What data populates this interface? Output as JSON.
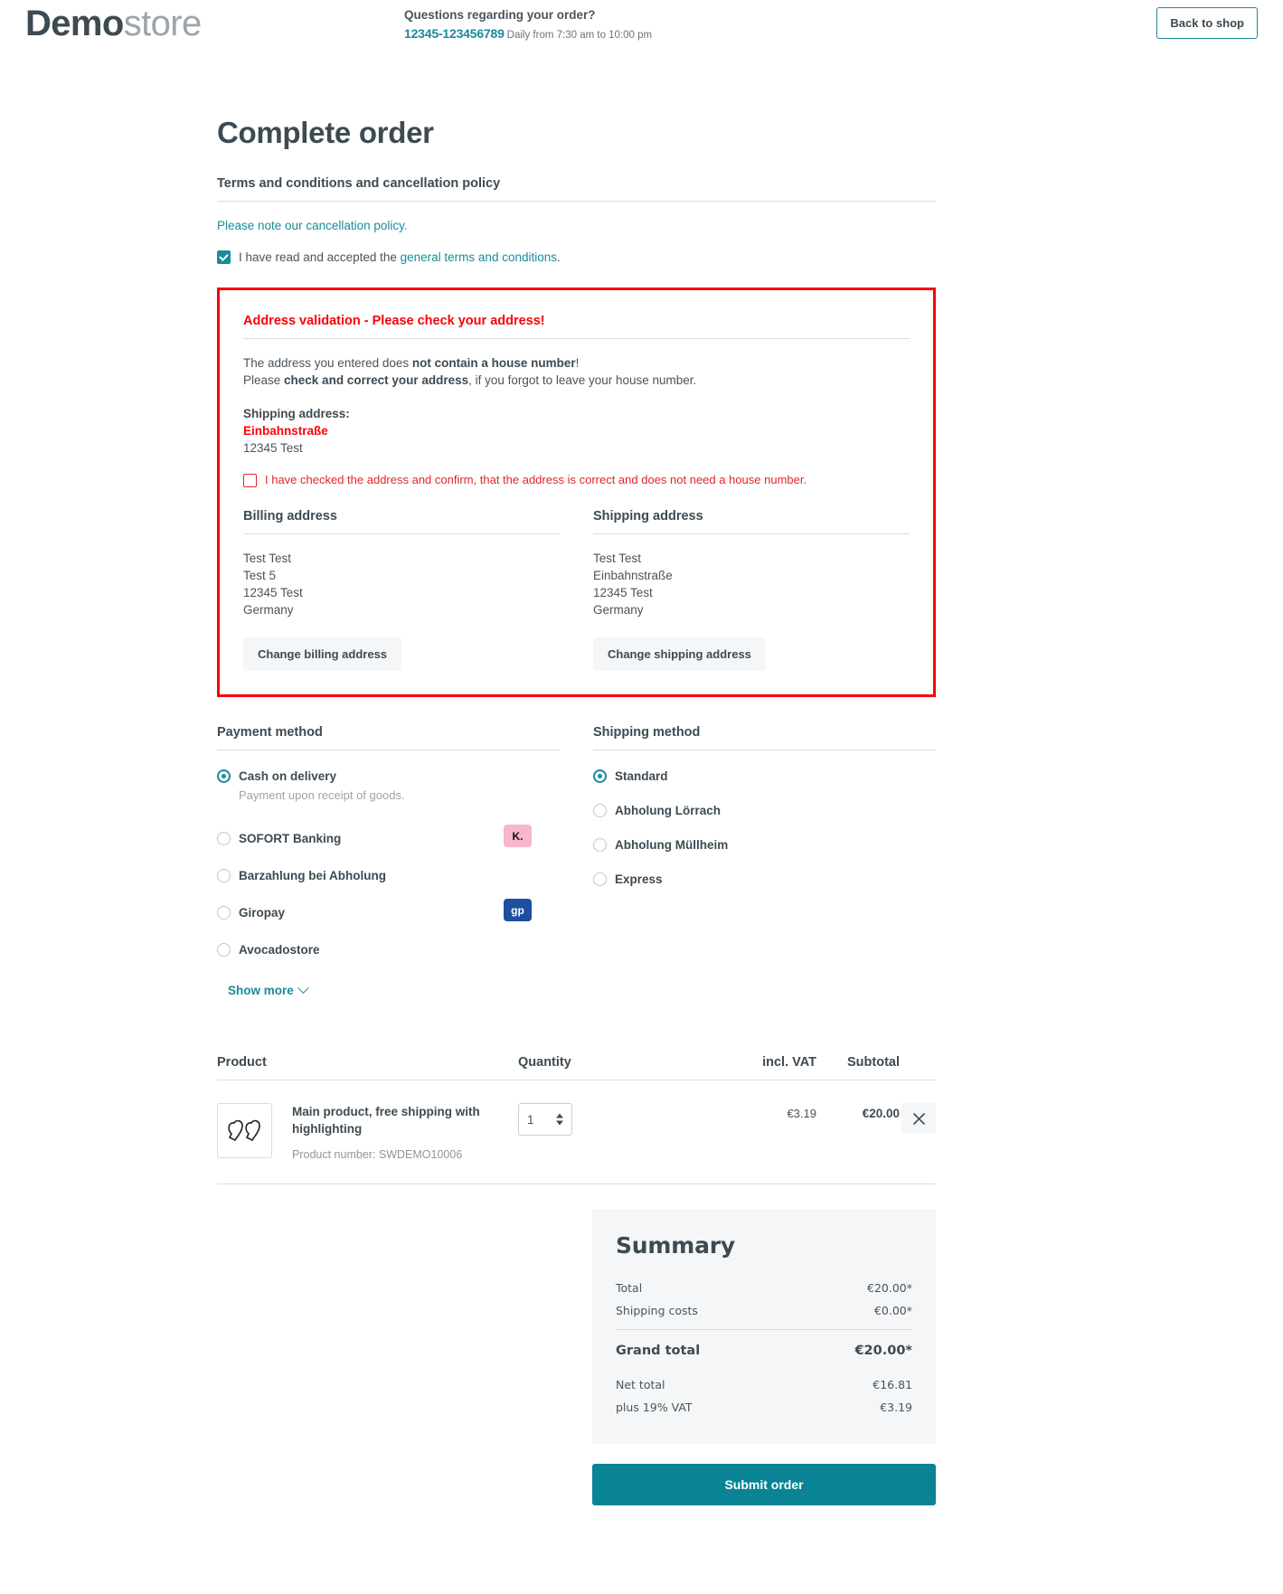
{
  "header": {
    "logo_bold": "Demo",
    "logo_light": "store",
    "contact_question": "Questions regarding your order?",
    "phone": "12345-123456789",
    "hours": "Daily from 7:30 am to 10:00 pm",
    "back_to_shop": "Back to shop"
  },
  "page": {
    "title": "Complete order"
  },
  "terms": {
    "heading": "Terms and conditions and cancellation policy",
    "cancellation_link": "Please note our cancellation policy.",
    "accept_prefix": "I have read and accepted the ",
    "accept_link": "general terms and conditions",
    "accept_suffix": ".",
    "accepted": true
  },
  "validation": {
    "title": "Address validation - Please check your address!",
    "line1_prefix": "The address you entered does ",
    "line1_bold": "not contain a house number",
    "line1_suffix": "!",
    "line2_prefix": "Please ",
    "line2_bold": "check and correct your address",
    "line2_suffix": ", if you forgot to leave your house number.",
    "shipping_label": "Shipping address:",
    "street": "Einbahnstraße",
    "city": "12345 Test",
    "confirm_text": "I have checked the address and confirm, that the address is correct and does not need a house number.",
    "confirm_checked": false,
    "border_color": "#fb0007",
    "text_color": "#e52427"
  },
  "addresses": {
    "billing": {
      "heading": "Billing address",
      "lines": [
        "Test Test",
        "Test 5",
        "12345 Test",
        "Germany"
      ],
      "button": "Change billing address"
    },
    "shipping": {
      "heading": "Shipping address",
      "lines": [
        "Test Test",
        "Einbahnstraße",
        "12345 Test",
        "Germany"
      ],
      "button": "Change shipping address"
    }
  },
  "payment": {
    "heading": "Payment method",
    "options": [
      {
        "label": "Cash on delivery",
        "sub": "Payment upon receipt of goods.",
        "selected": true,
        "badge": null
      },
      {
        "label": "SOFORT Banking",
        "sub": null,
        "selected": false,
        "badge": {
          "text": "K.",
          "type": "klarna"
        }
      },
      {
        "label": "Barzahlung bei Abholung",
        "sub": null,
        "selected": false,
        "badge": null
      },
      {
        "label": "Giropay",
        "sub": null,
        "selected": false,
        "badge": {
          "text": "gp",
          "type": "giropay"
        }
      },
      {
        "label": "Avocadostore",
        "sub": null,
        "selected": false,
        "badge": null
      }
    ],
    "show_more": "Show more"
  },
  "shipping_method": {
    "heading": "Shipping method",
    "options": [
      {
        "label": "Standard",
        "selected": true
      },
      {
        "label": "Abholung Lörrach",
        "selected": false
      },
      {
        "label": "Abholung Müllheim",
        "selected": false
      },
      {
        "label": "Express",
        "selected": false
      }
    ]
  },
  "cart": {
    "columns": [
      "Product",
      "Quantity",
      "incl. VAT",
      "Subtotal"
    ],
    "rows": [
      {
        "name": "Main product, free shipping with highlighting",
        "product_number": "Product number: SWDEMO10006",
        "quantity": "1",
        "vat": "€3.19",
        "subtotal": "€20.00"
      }
    ]
  },
  "summary": {
    "title": "Summary",
    "rows": [
      {
        "label": "Total",
        "value": "€20.00*"
      },
      {
        "label": "Shipping costs",
        "value": "€0.00*"
      }
    ],
    "grand_total_label": "Grand total",
    "grand_total_value": "€20.00*",
    "after_rows": [
      {
        "label": "Net total",
        "value": "€16.81"
      },
      {
        "label": "plus 19% VAT",
        "value": "€3.19"
      }
    ],
    "submit_label": "Submit order"
  },
  "colors": {
    "accent_teal": "#1b8a9c",
    "button_teal": "#0a8494",
    "error_red": "#fb0007",
    "text_dark": "#3e4a52"
  }
}
